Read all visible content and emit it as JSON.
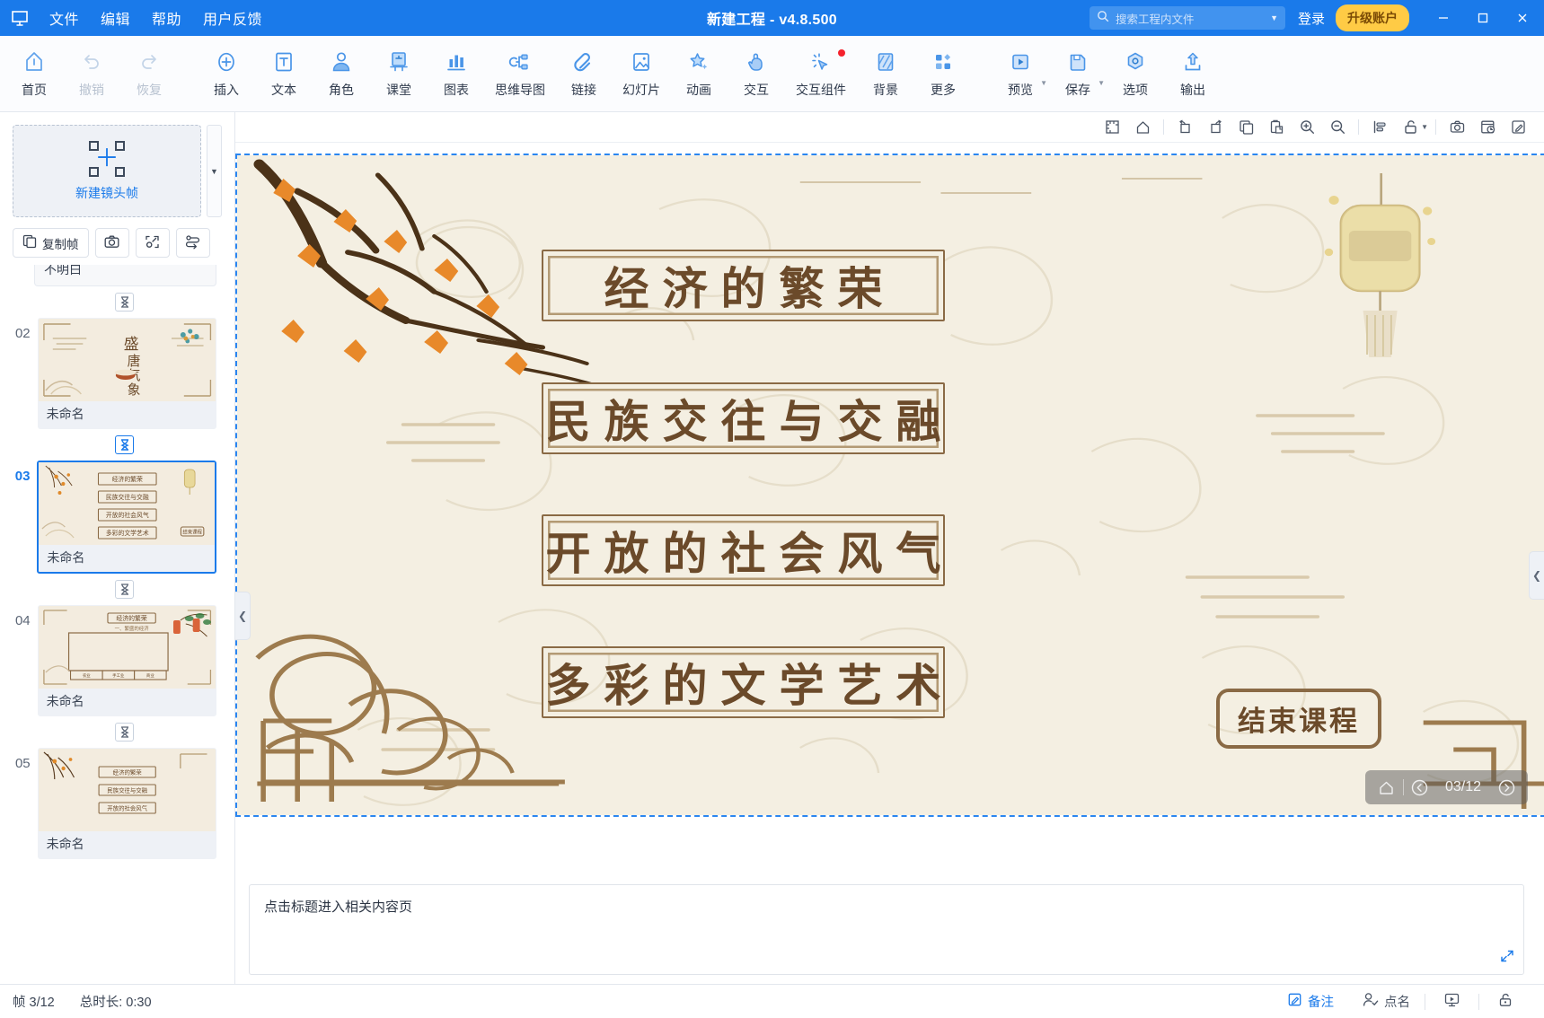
{
  "titlebar": {
    "logo_icon": "app-logo-icon",
    "menus": [
      "文件",
      "编辑",
      "帮助",
      "用户反馈"
    ],
    "title": "新建工程 - v4.8.500",
    "search": {
      "placeholder": "搜索工程内文件",
      "value": "",
      "icon": "search-icon",
      "caret": "▼"
    },
    "login_label": "登录",
    "upgrade_label": "升级账户",
    "window_buttons": {
      "minimize": "—",
      "maximize": "▢",
      "close": "✕"
    }
  },
  "ribbon": {
    "groups": [
      {
        "items": [
          {
            "label": "首页",
            "icon": "home-icon",
            "disabled": false
          },
          {
            "label": "撤销",
            "icon": "undo-icon",
            "disabled": true
          },
          {
            "label": "恢复",
            "icon": "redo-icon",
            "disabled": true
          }
        ]
      },
      {
        "items": [
          {
            "label": "插入",
            "icon": "plus-circle-icon",
            "disabled": false
          },
          {
            "label": "文本",
            "icon": "text-icon",
            "disabled": false
          },
          {
            "label": "角色",
            "icon": "role-avatar-icon",
            "disabled": false
          },
          {
            "label": "课堂",
            "icon": "classroom-icon",
            "disabled": false
          },
          {
            "label": "图表",
            "icon": "chart-icon",
            "disabled": false
          },
          {
            "label": "思维导图",
            "icon": "mindmap-icon",
            "disabled": false
          },
          {
            "label": "链接",
            "icon": "link-icon",
            "disabled": false
          },
          {
            "label": "幻灯片",
            "icon": "slide-image-icon",
            "disabled": false
          },
          {
            "label": "动画",
            "icon": "animation-star-icon",
            "disabled": false
          },
          {
            "label": "交互",
            "icon": "interaction-hand-icon",
            "disabled": false
          },
          {
            "label": "交互组件",
            "icon": "interaction-component-icon",
            "disabled": false,
            "badge": true
          },
          {
            "label": "背景",
            "icon": "background-icon",
            "disabled": false
          },
          {
            "label": "更多",
            "icon": "more-grid-icon",
            "disabled": false
          }
        ]
      },
      {
        "items": [
          {
            "label": "预览",
            "icon": "preview-play-icon",
            "disabled": false,
            "caret": true
          },
          {
            "label": "保存",
            "icon": "save-disk-icon",
            "disabled": false,
            "caret": true
          },
          {
            "label": "选项",
            "icon": "options-hex-icon",
            "disabled": false
          },
          {
            "label": "输出",
            "icon": "export-upload-icon",
            "disabled": false
          }
        ]
      }
    ]
  },
  "sidebar": {
    "new_frame_label": "新建镜头帧",
    "new_frame_icon": "add-frame-icon",
    "scroll_down_icon": "chevron-down-icon",
    "actions": [
      {
        "label": "复制帧",
        "icon": "copy-frame-icon"
      },
      {
        "label": "",
        "icon": "camera-icon"
      },
      {
        "label": "",
        "icon": "fit-frame-icon"
      },
      {
        "label": "",
        "icon": "reorder-path-icon"
      }
    ],
    "clipped_frame_caption": "不明白",
    "delay_icon": "hourglass-icon",
    "frames": [
      {
        "num": "02",
        "caption": "未命名",
        "selected": false,
        "thumb": "tang-dynasty-tea"
      },
      {
        "num": "03",
        "caption": "未命名",
        "selected": true,
        "thumb": "four-title-menu"
      },
      {
        "num": "04",
        "caption": "未命名",
        "selected": false,
        "thumb": "economy-content"
      },
      {
        "num": "05",
        "caption": "未命名",
        "selected": false,
        "thumb": "menu-branch"
      }
    ]
  },
  "canvas_toolbar": {
    "buttons": [
      {
        "icon": "ruler-icon"
      },
      {
        "icon": "home-frame-icon"
      },
      {
        "icon": "rotate-left-icon"
      },
      {
        "icon": "rotate-right-icon"
      },
      {
        "icon": "copy-icon"
      },
      {
        "icon": "paste-icon"
      },
      {
        "icon": "zoom-in-icon"
      },
      {
        "icon": "zoom-out-icon"
      },
      {
        "icon": "align-icon"
      },
      {
        "icon": "unlock-icon",
        "caret": true
      },
      {
        "icon": "snapshot-camera-icon"
      },
      {
        "icon": "history-icon"
      },
      {
        "icon": "edit-pencil-icon"
      }
    ]
  },
  "slide": {
    "background_color": "#f4efe2",
    "accent_color": "#8a6a45",
    "text_color": "#6b4a2a",
    "titles": [
      "经济的繁荣",
      "民族交往与交融",
      "开放的社会风气",
      "多彩的文学艺术"
    ],
    "end_button_label": "结束课程",
    "hud": {
      "home_icon": "home-icon",
      "prev_icon": "prev-circle-icon",
      "page_indicator": "03/12",
      "next_icon": "next-circle-icon"
    },
    "collapse_left_icon": "chevron-left-icon",
    "collapse_right_icon": "chevron-left-icon"
  },
  "notes": {
    "value": "点击标题进入相关内容页",
    "expand_icon": "expand-arrows-icon"
  },
  "statusbar": {
    "frame_label": "帧 3/12",
    "duration_label": "总时长: 0:30",
    "items": [
      {
        "label": "备注",
        "icon": "note-pencil-icon",
        "active": true
      },
      {
        "label": "点名",
        "icon": "roll-call-icon",
        "active": false
      }
    ],
    "icon_buttons": [
      {
        "icon": "present-screen-icon"
      },
      {
        "icon": "lock-icon"
      }
    ]
  }
}
